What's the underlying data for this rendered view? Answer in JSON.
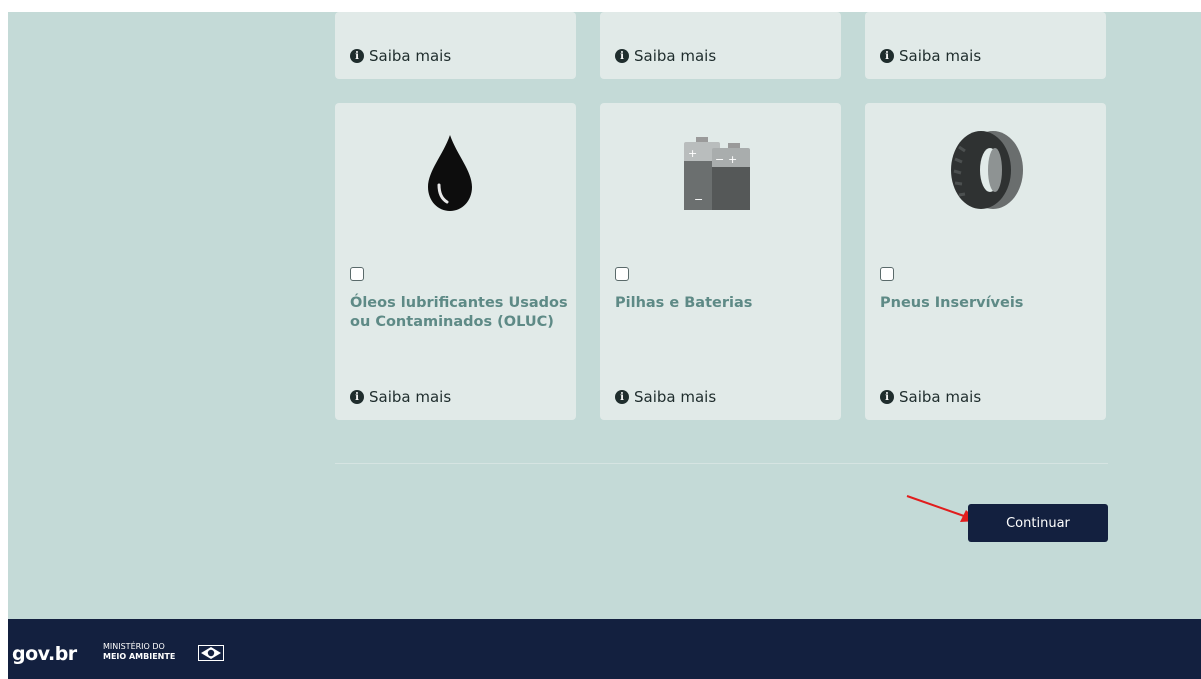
{
  "cards_top_row": [
    {
      "info_label": "Saiba mais"
    },
    {
      "info_label": "Saiba mais"
    },
    {
      "info_label": "Saiba mais"
    }
  ],
  "cards": [
    {
      "title": "Óleos lubrificantes Usados ou Contaminados (OLUC)",
      "info_label": "Saiba mais",
      "icon": "oil-drop-icon",
      "checked": false
    },
    {
      "title": "Pilhas e Baterias",
      "info_label": "Saiba mais",
      "icon": "battery-icon",
      "checked": false
    },
    {
      "title": "Pneus Inservíveis",
      "info_label": "Saiba mais",
      "icon": "tire-icon",
      "checked": false
    }
  ],
  "actions": {
    "continue_label": "Continuar"
  },
  "footer": {
    "logo_text": "gov.br",
    "ministry_line1": "MINISTÉRIO DO",
    "ministry_line2": "MEIO AMBIENTE"
  },
  "colors": {
    "page_bg": "#c4dad7",
    "card_bg": "#e1eae8",
    "title_color": "#5e8a86",
    "button_bg": "#13203f",
    "footer_bg": "#13203f",
    "annotation_arrow": "#e11d1d"
  }
}
